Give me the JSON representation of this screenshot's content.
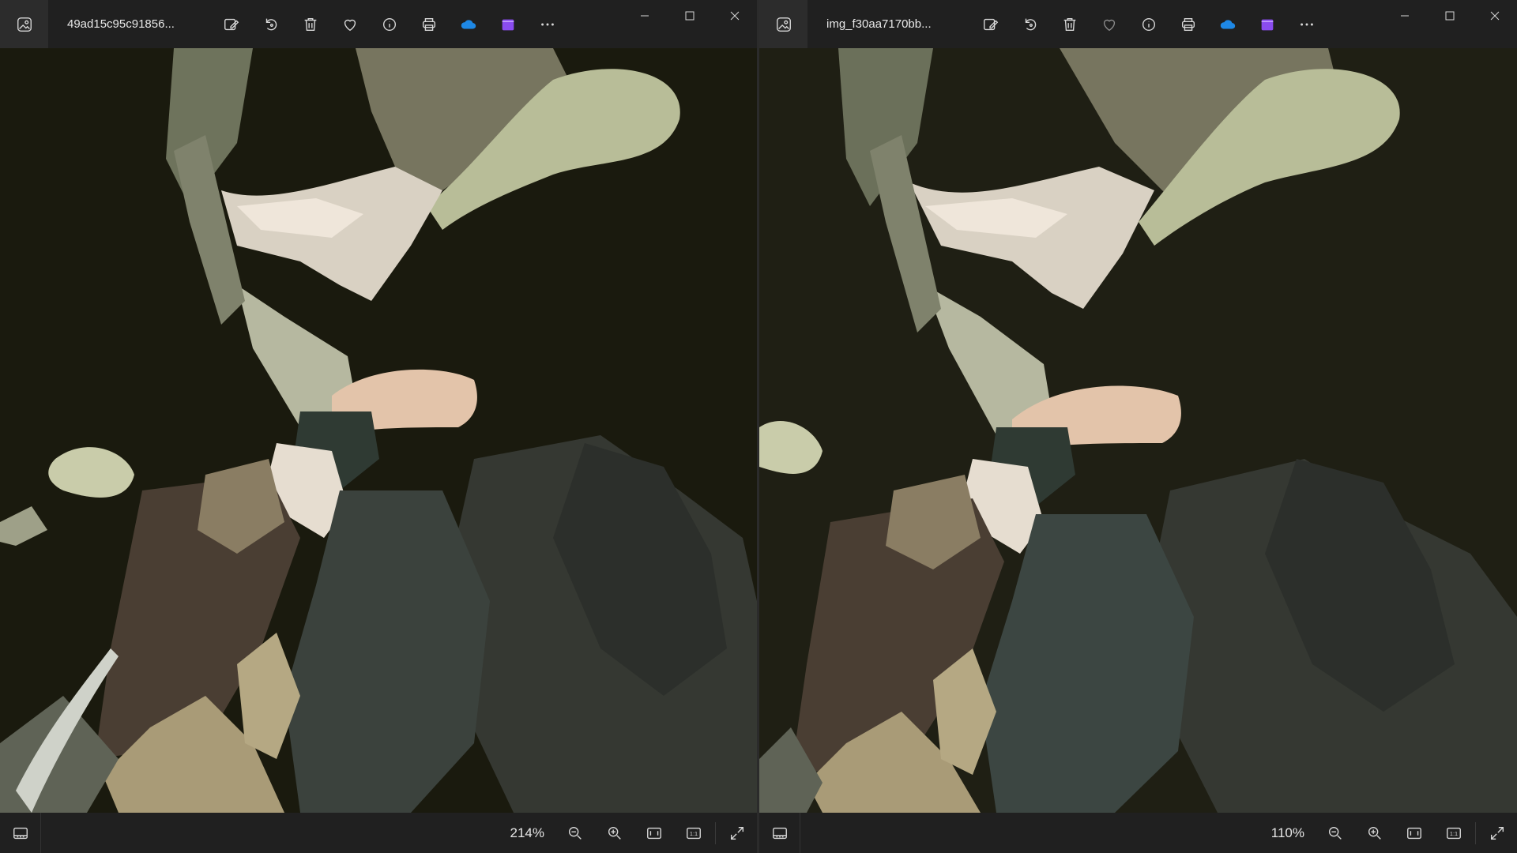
{
  "windows": [
    {
      "filename": "49ad15c95c91856...",
      "zoom": "214%",
      "favorite_filled": false
    },
    {
      "filename": "img_f30aa7170bb...",
      "zoom": "110%",
      "favorite_filled": false
    }
  ],
  "toolbar_icons": [
    "edit-image-icon",
    "rotate-icon",
    "delete-icon",
    "favorite-icon",
    "info-icon",
    "print-icon",
    "onedrive-icon",
    "clipchamp-icon",
    "more-icon"
  ],
  "status_icons": [
    "filmstrip-icon",
    "zoom-out-icon",
    "zoom-in-icon",
    "fit-to-window-icon",
    "actual-size-icon",
    "fullscreen-icon"
  ],
  "status_labels": {
    "actual_size": "1:1"
  },
  "colors": {
    "chrome": "#202020",
    "onedrive": "#1e88e5",
    "clipchamp": "#8a4cf0",
    "artwork_background": "#1a1a0f"
  }
}
